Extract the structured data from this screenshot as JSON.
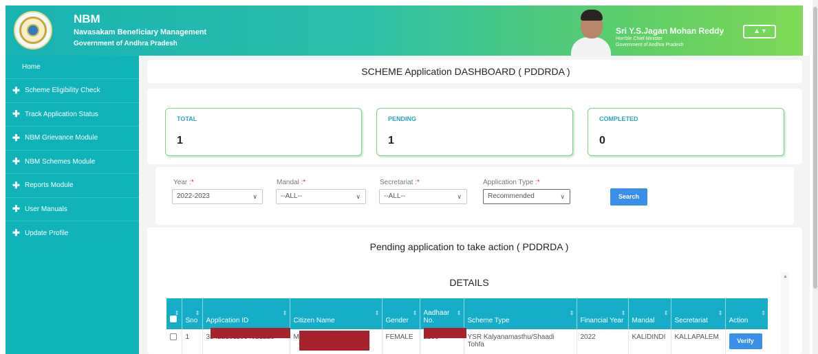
{
  "header": {
    "brand_title": "NBM",
    "brand_subtitle": "Navasakam Beneficiary Management",
    "brand_gov": "Government of Andhra Pradesh",
    "cm_name": "Sri Y.S.Jagan Mohan Reddy",
    "cm_role": "Hon'ble Chief Minister",
    "cm_gov": "Government of Andhra Pradesh",
    "user_menu_icon": "user-icon",
    "user_menu_caret": "▾"
  },
  "sidebar": {
    "items": [
      {
        "label": "Home",
        "plus": ""
      },
      {
        "label": "Scheme Eligibility Check",
        "plus": "✚"
      },
      {
        "label": "Track Application Status",
        "plus": "✚"
      },
      {
        "label": "NBM Grievance Module",
        "plus": "✚"
      },
      {
        "label": "NBM Schemes Module",
        "plus": "✚"
      },
      {
        "label": "Reports Module",
        "plus": "✚"
      },
      {
        "label": "User Manuals",
        "plus": "✚"
      },
      {
        "label": "Update Profile",
        "plus": "✚"
      }
    ]
  },
  "dashboard": {
    "title": "SCHEME Application DASHBOARD ( PDDRDA )",
    "stats": [
      {
        "label": "TOTAL",
        "value": "1"
      },
      {
        "label": "PENDING",
        "value": "1"
      },
      {
        "label": "COMPLETED",
        "value": "0"
      }
    ]
  },
  "filters": {
    "year_label": "Year :",
    "year_value": "2022-2023",
    "mandal_label": "Mandal :",
    "mandal_value": "--ALL--",
    "secretariat_label": "Secretariat :",
    "secretariat_value": "--ALL--",
    "apptype_label": "Application Type :",
    "apptype_value": "Recommended",
    "required_mark": "*",
    "search_label": "Search"
  },
  "pending": {
    "title": "Pending application to take action ( PDDRDA )",
    "details_title": "DETAILS"
  },
  "table": {
    "headers": [
      "Sno",
      "Application ID",
      "Citizen Name",
      "Gender",
      "Aadhaar No.",
      "Scheme Type",
      "Financial Year",
      "Mandal",
      "Secretariat",
      "Action"
    ],
    "rows": [
      {
        "sno": "1",
        "application_id": "334221811034021229",
        "citizen_name": "M",
        "gender": "FEMALE",
        "aadhaar": "2299",
        "scheme_type": "YSR Kalyanamasthu/Shaadi Tohfa",
        "financial_year": "2022",
        "mandal": "KALIDINDI",
        "secretariat": "KALLAPALEM",
        "action": "Verify"
      }
    ]
  },
  "colors": {
    "sidebar": "#10b3b7",
    "table_header": "#16adc9",
    "button": "#3a8fe8",
    "stat_border": "#7ccf8c"
  }
}
